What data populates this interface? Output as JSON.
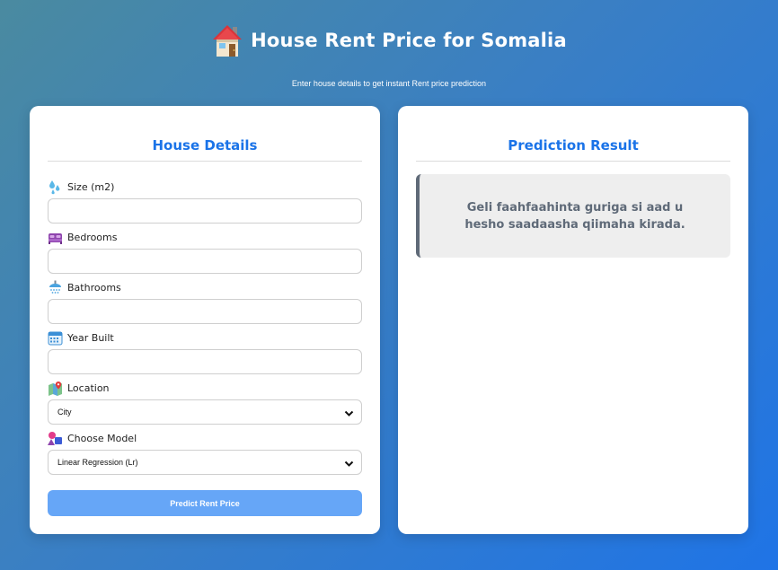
{
  "header": {
    "title": "House Rent Price for Somalia",
    "subtitle": "Enter house details to get instant Rent price prediction",
    "icon": "house-icon"
  },
  "form": {
    "heading": "House Details",
    "fields": [
      {
        "label": "Size (m2)",
        "icon": "droplets-icon",
        "value": "",
        "placeholder": ""
      },
      {
        "label": "Bedrooms",
        "icon": "bed-icon",
        "value": "",
        "placeholder": ""
      },
      {
        "label": "Bathrooms",
        "icon": "shower-icon",
        "value": "",
        "placeholder": ""
      },
      {
        "label": "Year Built",
        "icon": "calendar-icon",
        "value": "",
        "placeholder": ""
      }
    ],
    "location": {
      "label": "Location",
      "icon": "map-pin-icon",
      "selected": "City"
    },
    "model": {
      "label": "Choose Model",
      "icon": "shapes-icon",
      "selected": "Linear Regression (Lr)"
    },
    "submit_label": "Predict Rent Price"
  },
  "result": {
    "heading": "Prediction Result",
    "message": "Geli faahfaahinta guriga si aad u hesho saadaasha qiimaha kirada."
  },
  "colors": {
    "accent": "#1a73e8",
    "button": "#66a6f7",
    "result_border": "#5f6a78",
    "result_bg": "#eeeeee"
  }
}
